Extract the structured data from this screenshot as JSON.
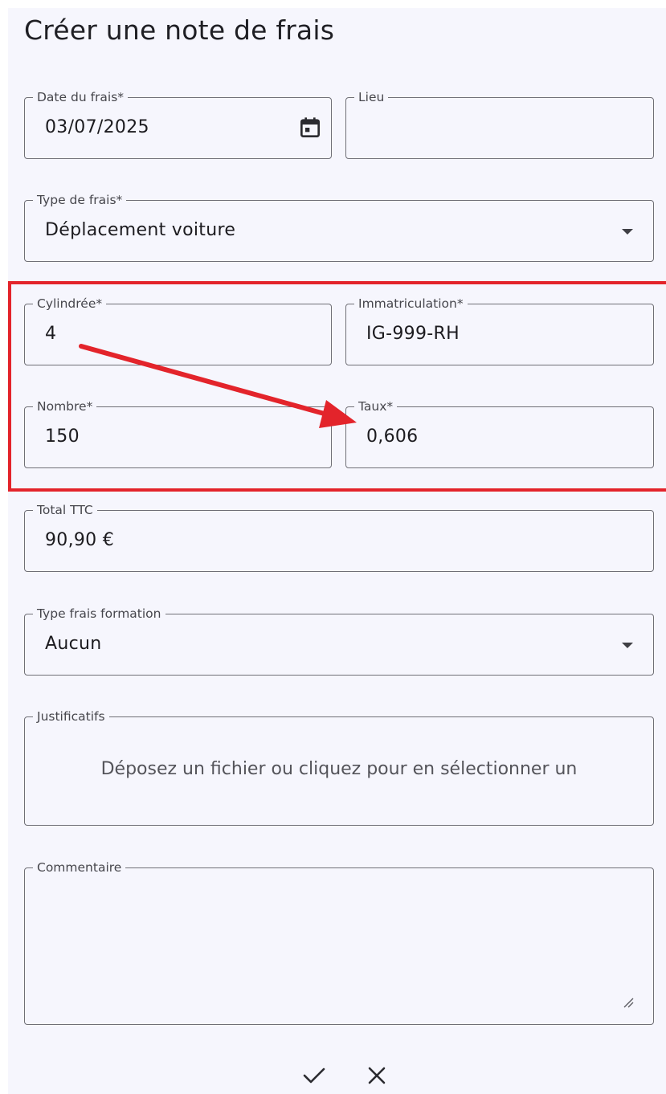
{
  "page": {
    "title": "Créer une note de frais"
  },
  "form": {
    "date": {
      "label": "Date du frais*",
      "value": "03/07/2025"
    },
    "lieu": {
      "label": "Lieu",
      "value": ""
    },
    "type_frais": {
      "label": "Type de frais*",
      "value": "Déplacement voiture"
    },
    "cylindree": {
      "label": "Cylindrée*",
      "value": "4"
    },
    "immatriculation": {
      "label": "Immatriculation*",
      "value": "IG-999-RH"
    },
    "nombre": {
      "label": "Nombre*",
      "value": "150"
    },
    "taux": {
      "label": "Taux*",
      "value": "0,606"
    },
    "total_ttc": {
      "label": "Total TTC",
      "value": "90,90 €"
    },
    "type_frais_formation": {
      "label": "Type frais formation",
      "value": "Aucun"
    },
    "justificatifs": {
      "label": "Justificatifs",
      "placeholder": "Déposez un fichier ou cliquez pour en sélectionner un"
    },
    "commentaire": {
      "label": "Commentaire",
      "value": ""
    }
  },
  "actions": {
    "confirm_icon": "check-icon",
    "cancel_icon": "close-icon"
  },
  "icons": {
    "date_picker": "calendar-icon",
    "select_caret": "caret-down-icon",
    "resize": "resize-grip-icon"
  },
  "colors": {
    "annotation_red": "#e3242b",
    "panel_background": "#f6f6fd",
    "field_border": "#6f6f76"
  }
}
